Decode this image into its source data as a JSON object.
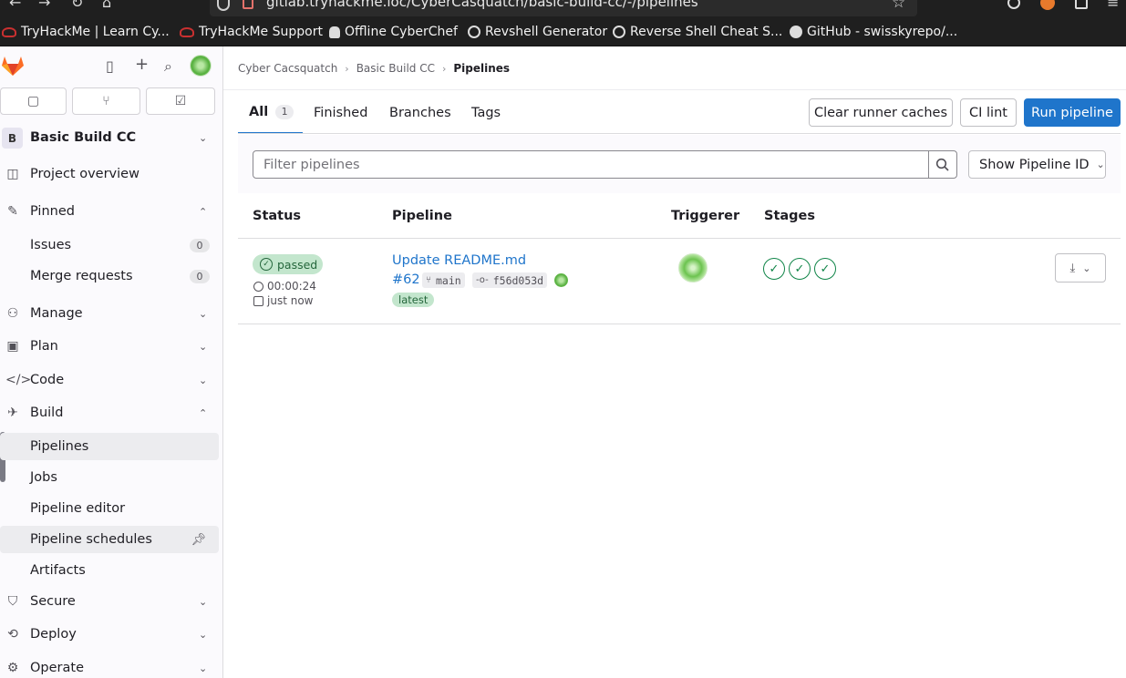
{
  "browser": {
    "url": "gitlab.tryhackme.loc/CyberCasquatch/basic-build-cc/-/pipelines",
    "bookmarks": [
      {
        "label": "TryHackMe | Learn Cy...",
        "icon": "tryhackme-icon"
      },
      {
        "label": "TryHackMe Support",
        "icon": "tryhackme-icon"
      },
      {
        "label": "Offline CyberChef",
        "icon": "chef-hat-icon"
      },
      {
        "label": "Revshell Generator",
        "icon": "globe-icon"
      },
      {
        "label": "Reverse Shell Cheat S...",
        "icon": "globe-icon"
      },
      {
        "label": "GitHub - swisskyrepo/...",
        "icon": "github-icon"
      }
    ]
  },
  "sidebar": {
    "project_initial": "B",
    "project_name": "Basic Build CC",
    "items": {
      "project_overview": "Project overview",
      "pinned": "Pinned",
      "issues": "Issues",
      "issues_count": "0",
      "merge_requests": "Merge requests",
      "merge_requests_count": "0",
      "manage": "Manage",
      "plan": "Plan",
      "code": "Code",
      "build": "Build",
      "pipelines": "Pipelines",
      "jobs": "Jobs",
      "pipeline_editor": "Pipeline editor",
      "pipeline_schedules": "Pipeline schedules",
      "artifacts": "Artifacts",
      "secure": "Secure",
      "deploy": "Deploy",
      "operate": "Operate"
    }
  },
  "breadcrumb": [
    "Cyber Cacsquatch",
    "Basic Build CC",
    "Pipelines"
  ],
  "tabs": {
    "all": "All",
    "all_count": "1",
    "finished": "Finished",
    "branches": "Branches",
    "tags": "Tags"
  },
  "actions": {
    "clear_caches": "Clear runner caches",
    "ci_lint": "CI lint",
    "run_pipeline": "Run pipeline"
  },
  "filter": {
    "placeholder": "Filter pipelines",
    "show_id": "Show Pipeline ID"
  },
  "table": {
    "headers": [
      "Status",
      "Pipeline",
      "Triggerer",
      "Stages"
    ],
    "row": {
      "status": "passed",
      "duration": "00:00:24",
      "finished": "just now",
      "title": "Update README.md",
      "id": "#62",
      "branch": "main",
      "commit": "f56d053d",
      "tag": "latest",
      "stages": [
        "passed",
        "passed",
        "passed"
      ]
    }
  },
  "colors": {
    "accent": "#1f75cb",
    "success": "#108548",
    "success_bg": "#c3e6cd"
  }
}
